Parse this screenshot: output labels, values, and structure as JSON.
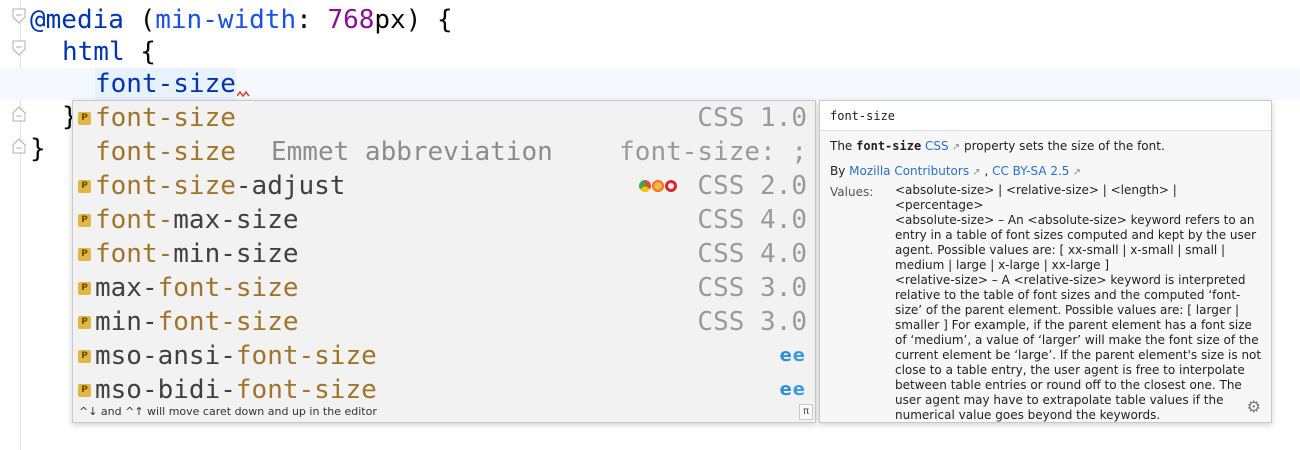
{
  "editor": {
    "line1": {
      "at": "@media",
      "open_paren": " (",
      "feature": "min-width",
      "colon": ": ",
      "number": "768",
      "unit": "px",
      "rest": ") {"
    },
    "line2": {
      "selector": "html",
      "brace": " {"
    },
    "line3": {
      "typed": "font-size"
    },
    "line4": {
      "text": "}"
    },
    "line5": {
      "text": "}"
    }
  },
  "completion": {
    "items": [
      {
        "prefix": "",
        "match": "font-size",
        "suffix": "",
        "extra": "",
        "type": "CSS 1.0",
        "badge": "P",
        "browsers": []
      },
      {
        "prefix": "",
        "match": "font-size",
        "suffix": "",
        "extra": "Emmet abbreviation",
        "type": "font-size: ;",
        "badge": "",
        "browsers": []
      },
      {
        "prefix": "",
        "match": "font-size",
        "suffix": "-adjust",
        "extra": "",
        "type": "CSS 2.0",
        "badge": "P",
        "browsers": [
          "chrome-icon",
          "firefox-icon",
          "opera-icon"
        ]
      },
      {
        "prefix": "",
        "match": "font-",
        "suffix": "max-size",
        "extra": "",
        "type": "CSS 4.0",
        "badge": "P",
        "browsers": []
      },
      {
        "prefix": "",
        "match": "font-",
        "suffix": "min-size",
        "extra": "",
        "type": "CSS 4.0",
        "badge": "P",
        "browsers": []
      },
      {
        "prefix": "max-",
        "match": "font-size",
        "suffix": "",
        "extra": "",
        "type": "CSS 3.0",
        "badge": "P",
        "browsers": []
      },
      {
        "prefix": "min-",
        "match": "font-size",
        "suffix": "",
        "extra": "",
        "type": "CSS 3.0",
        "badge": "P",
        "browsers": []
      },
      {
        "prefix": "mso-ansi-",
        "match": "font-size",
        "suffix": "",
        "extra": "",
        "type": "",
        "badge": "P",
        "browsers": [
          "ie-icon",
          "edge-icon"
        ]
      },
      {
        "prefix": "mso-bidi-",
        "match": "font-size",
        "suffix": "",
        "extra": "",
        "type": "",
        "badge": "P",
        "browsers": [
          "ie-icon",
          "edge-icon"
        ]
      }
    ],
    "footer": "^↓ and ^↑ will move caret down and up in the editor",
    "pi_label": "π"
  },
  "doc": {
    "title": "font-size",
    "desc_the": "The ",
    "desc_prop": "font-size",
    "desc_link": "CSS",
    "desc_ext": " ↗",
    "desc_rest": "  property sets the size of the font.",
    "by_label": "By ",
    "by_author": "Mozilla Contributors",
    "by_sep": " , ",
    "by_license": "CC BY-SA 2.5",
    "values_label": "Values:",
    "values": [
      "<absolute-size> | <relative-size> | <length> | <percentage>",
      "<absolute-size> – An <absolute-size> keyword refers to an entry in a table of font sizes computed and kept by the user agent. Possible values are: [ xx-small | x-small | small | medium | large | x-large | xx-large ]",
      "<relative-size> – A <relative-size> keyword is interpreted relative to the table of font sizes and the computed ‘font-size’ of the parent element. Possible values are: [ larger | smaller ] For example, if the parent element has a font size of ‘medium’, a value of ‘larger’ will make the font size of the current element be ‘large’. If the parent element's size is not close to a table entry, the user agent is free to interpolate between table entries or round off to the closest one. The user agent may have to extrapolate table values if the numerical value goes beyond the keywords."
    ]
  },
  "colors": {
    "match": "#a0742a",
    "badge": "#e0b647",
    "link": "#2a6fc9",
    "keyword": "#0033b3"
  }
}
